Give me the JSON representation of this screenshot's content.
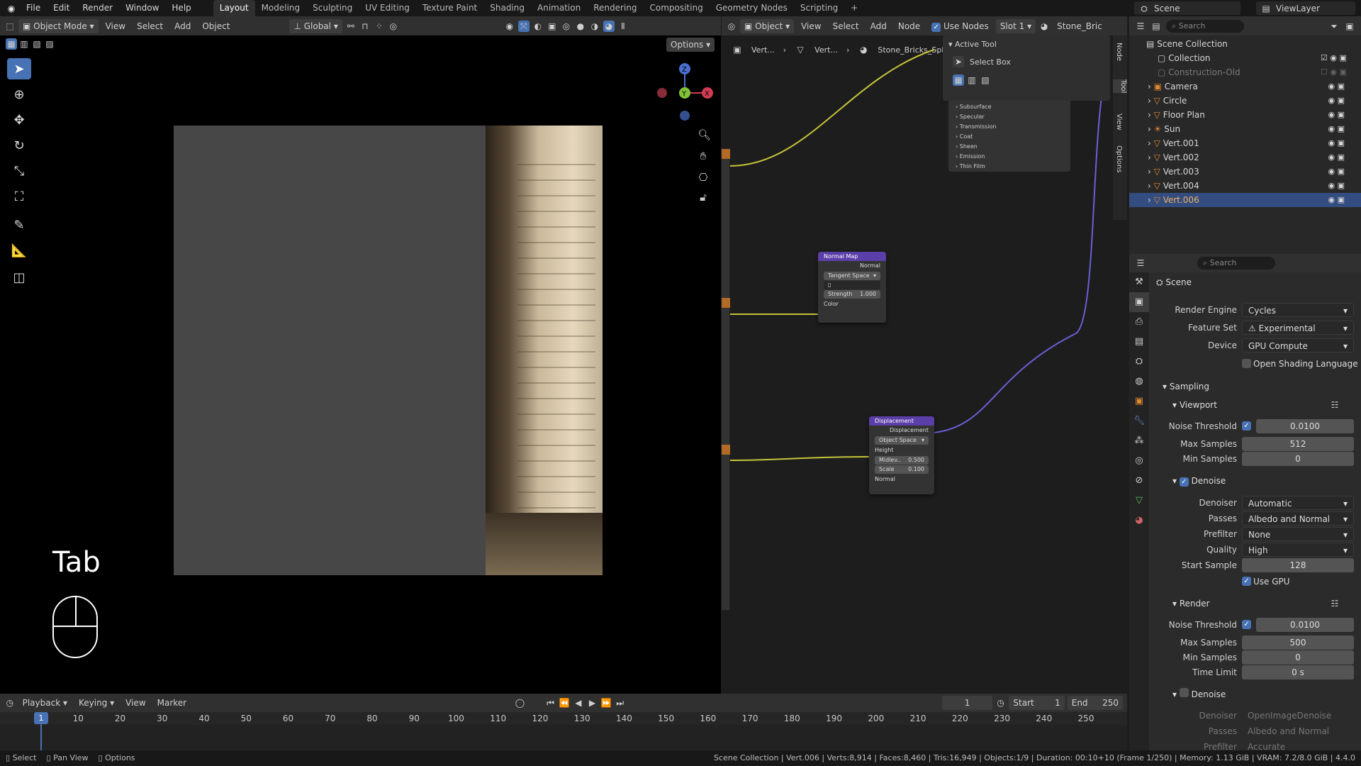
{
  "topbar": {
    "menus": [
      "File",
      "Edit",
      "Render",
      "Window",
      "Help"
    ],
    "workspaces": [
      "Layout",
      "Modeling",
      "Sculpting",
      "UV Editing",
      "Texture Paint",
      "Shading",
      "Animation",
      "Rendering",
      "Compositing",
      "Geometry Nodes",
      "Scripting"
    ],
    "active_workspace": "Layout",
    "scene_label": "Scene",
    "viewlayer_label": "ViewLayer"
  },
  "viewport_header": {
    "mode": "Object Mode",
    "menus": [
      "View",
      "Select",
      "Add",
      "Object"
    ],
    "orientation": "Global",
    "options_label": "Options"
  },
  "viewport": {
    "key_overlay": "Tab",
    "gizmo": {
      "z": "Z",
      "y": "Y",
      "x": "X"
    }
  },
  "node_header": {
    "object_dropdown": "Object",
    "menus": [
      "View",
      "Select",
      "Add",
      "Node"
    ],
    "use_nodes_label": "Use Nodes",
    "slot": "Slot 1",
    "material": "Stone_Bric"
  },
  "breadcrumb": [
    "Vert...",
    "Vert...",
    "Stone_Bricks_Spl..."
  ],
  "active_tool_panel": {
    "title": "Active Tool",
    "tool_name": "Select Box",
    "bsdf_items": [
      "Subsurface",
      "Specular",
      "Transmission",
      "Coat",
      "Sheen",
      "Emission",
      "Thin Film"
    ]
  },
  "side_tabs": [
    "Node",
    "Tool",
    "View",
    "Options"
  ],
  "nodes": {
    "normal_map": {
      "title": "Normal Map",
      "output": "Normal",
      "space": "Tangent Space",
      "strength_label": "Strength",
      "strength_value": "1.000",
      "input": "Color"
    },
    "displacement": {
      "title": "Displacement",
      "output": "Displacement",
      "space": "Object Space",
      "height": "Height",
      "midlevel_label": "Midlev..",
      "midlevel_value": "0.500",
      "scale_label": "Scale",
      "scale_value": "0.100",
      "normal": "Normal"
    }
  },
  "outliner": {
    "search_placeholder": "Search",
    "root": "Scene Collection",
    "items": [
      {
        "name": "Collection",
        "icon": "collection-icon"
      },
      {
        "name": "Construction-Old",
        "icon": "collection-icon"
      },
      {
        "name": "Camera",
        "icon": "camera-icon"
      },
      {
        "name": "Circle",
        "icon": "mesh-icon"
      },
      {
        "name": "Floor Plan",
        "icon": "mesh-icon"
      },
      {
        "name": "Sun",
        "icon": "light-icon"
      },
      {
        "name": "Vert.001",
        "icon": "mesh-icon"
      },
      {
        "name": "Vert.002",
        "icon": "mesh-icon"
      },
      {
        "name": "Vert.003",
        "icon": "mesh-icon"
      },
      {
        "name": "Vert.004",
        "icon": "mesh-icon"
      },
      {
        "name": "Vert.006",
        "icon": "mesh-icon"
      }
    ],
    "selected": "Vert.006"
  },
  "properties": {
    "search_placeholder": "Search",
    "context": "Scene",
    "render_engine_label": "Render Engine",
    "render_engine": "Cycles",
    "feature_set_label": "Feature Set",
    "feature_set": "Experimental",
    "device_label": "Device",
    "device": "GPU Compute",
    "osl_label": "Open Shading Language",
    "sampling": "Sampling",
    "viewport": "Viewport",
    "vp_noise_label": "Noise Threshold",
    "vp_noise": "0.0100",
    "vp_max_label": "Max Samples",
    "vp_max": "512",
    "vp_min_label": "Min Samples",
    "vp_min": "0",
    "denoise": "Denoise",
    "denoiser_label": "Denoiser",
    "denoiser": "Automatic",
    "passes_label": "Passes",
    "passes": "Albedo and Normal",
    "prefilter_label": "Prefilter",
    "prefilter": "None",
    "quality_label": "Quality",
    "quality": "High",
    "start_sample_label": "Start Sample",
    "start_sample": "128",
    "use_gpu_label": "Use GPU",
    "render": "Render",
    "r_noise_label": "Noise Threshold",
    "r_noise": "0.0100",
    "r_max_label": "Max Samples",
    "r_max": "500",
    "r_min_label": "Min Samples",
    "r_min": "0",
    "time_limit_label": "Time Limit",
    "time_limit": "0 s",
    "denoise2": "Denoise",
    "r_denoiser_label": "Denoiser",
    "r_denoiser": "OpenImageDenoise",
    "r_passes_label": "Passes",
    "r_passes": "Albedo and Normal",
    "r_prefilter_label": "Prefilter",
    "r_prefilter": "Accurate"
  },
  "timeline": {
    "menus": [
      "Playback",
      "Keying",
      "View",
      "Marker"
    ],
    "current_frame": "1",
    "start_label": "Start",
    "start": "1",
    "end_label": "End",
    "end": "250",
    "ticks": [
      "1",
      "10",
      "20",
      "30",
      "40",
      "50",
      "60",
      "70",
      "80",
      "90",
      "100",
      "110",
      "120",
      "130",
      "140",
      "150",
      "160",
      "170",
      "180",
      "190",
      "200",
      "210",
      "220",
      "230",
      "240",
      "250"
    ]
  },
  "statusbar": {
    "left": [
      "Select",
      "Pan View",
      "Options"
    ],
    "info": "Scene Collection | Vert.006 | Verts:8,914 | Faces:8,460 | Tris:16,949 | Objects:1/9 | Duration: 00:10+10 (Frame 1/250) | Memory: 1.13 GiB | VRAM: 7.2/8.0 GiB | 4.4.0"
  }
}
